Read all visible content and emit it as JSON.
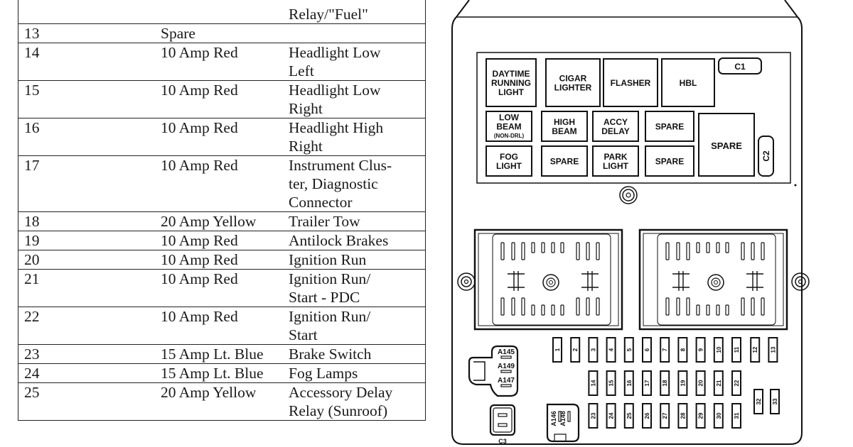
{
  "table": {
    "rows": [
      {
        "cavity": "",
        "fuse": "",
        "description": [
          "",
          "Relay/\"Fuel\""
        ]
      },
      {
        "cavity": "13",
        "fuse": "Spare",
        "description": [
          ""
        ]
      },
      {
        "cavity": "14",
        "fuse": "10 Amp Red",
        "description": [
          "Headlight Low",
          "Left"
        ]
      },
      {
        "cavity": "15",
        "fuse": "10 Amp Red",
        "description": [
          "Headlight Low",
          "Right"
        ]
      },
      {
        "cavity": "16",
        "fuse": "10 Amp Red",
        "description": [
          "Headlight High",
          "Right"
        ]
      },
      {
        "cavity": "17",
        "fuse": "10 Amp Red",
        "description": [
          "Instrument Clus-",
          "ter, Diagnostic",
          "Connector"
        ]
      },
      {
        "cavity": "18",
        "fuse": "20 Amp Yellow",
        "description": [
          "Trailer Tow"
        ]
      },
      {
        "cavity": "19",
        "fuse": "10 Amp Red",
        "description": [
          "Antilock Brakes"
        ]
      },
      {
        "cavity": "20",
        "fuse": "10 Amp Red",
        "description": [
          "Ignition Run"
        ]
      },
      {
        "cavity": "21",
        "fuse": "10 Amp Red",
        "description": [
          "Ignition Run/",
          "Start - PDC"
        ]
      },
      {
        "cavity": "22",
        "fuse": "10 Amp Red",
        "description": [
          "Ignition Run/",
          "Start"
        ]
      },
      {
        "cavity": "23",
        "fuse": "15 Amp Lt. Blue",
        "description": [
          "Brake Switch"
        ]
      },
      {
        "cavity": "24",
        "fuse": "15 Amp Lt. Blue",
        "description": [
          "Fog Lamps"
        ]
      },
      {
        "cavity": "25",
        "fuse": "20 Amp Yellow",
        "description": [
          "Accessory Delay",
          "Relay (Sunroof)"
        ]
      }
    ]
  },
  "diagram": {
    "relays_top": [
      {
        "lines": [
          "DAYTIME",
          "RUNNING",
          "LIGHT"
        ]
      },
      {
        "lines": [
          "CIGAR",
          "LIGHTER"
        ]
      },
      {
        "lines": [
          "FLASHER"
        ]
      },
      {
        "lines": [
          "HBL"
        ]
      }
    ],
    "relays_mid": [
      {
        "lines": [
          "LOW",
          "BEAM",
          "(NON-DRL)"
        ]
      },
      {
        "lines": [
          "HIGH",
          "BEAM"
        ]
      },
      {
        "lines": [
          "ACCY",
          "DELAY"
        ]
      },
      {
        "lines": [
          "SPARE"
        ]
      }
    ],
    "relays_bot": [
      {
        "lines": [
          "FOG",
          "LIGHT"
        ]
      },
      {
        "lines": [
          "SPARE"
        ]
      },
      {
        "lines": [
          "PARK",
          "LIGHT"
        ]
      },
      {
        "lines": [
          "SPARE"
        ]
      }
    ],
    "relay_large": "SPARE",
    "connector_c1": "C1",
    "connector_c2": "C2",
    "connector_c3": "C3",
    "circuit_breakers_upper": [
      "A145",
      "A149",
      "A147"
    ],
    "circuit_breakers_lower": [
      "A146",
      "A148"
    ],
    "fuses_row1": [
      "1",
      "2",
      "3",
      "4",
      "5",
      "6",
      "7",
      "8",
      "9",
      "10",
      "11",
      "12",
      "13"
    ],
    "fuses_row2": [
      "14",
      "15",
      "16",
      "17",
      "18",
      "19",
      "20",
      "21",
      "22"
    ],
    "fuses_row3": [
      "23",
      "24",
      "25",
      "26",
      "27",
      "28",
      "29",
      "30",
      "31"
    ],
    "fuses_side": [
      "32",
      "33"
    ]
  }
}
